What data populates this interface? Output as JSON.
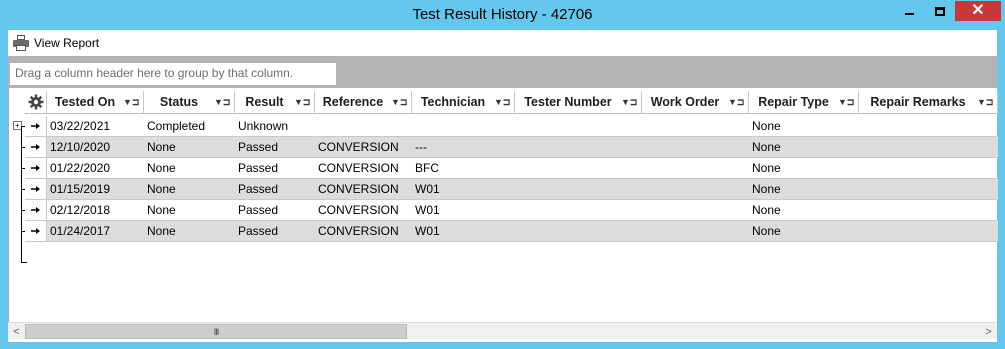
{
  "window": {
    "title": "Test Result History - 42706",
    "controls": {
      "minimize": "minimize",
      "maximize": "maximize",
      "close": "✕"
    }
  },
  "toolbar": {
    "view_report_label": "View Report",
    "icon": "printer-icon"
  },
  "group_panel": {
    "hint": "Drag a column header here to group by that column."
  },
  "grid": {
    "columns": [
      {
        "key": "tested_on",
        "label": "Tested On"
      },
      {
        "key": "status",
        "label": "Status"
      },
      {
        "key": "result",
        "label": "Result"
      },
      {
        "key": "reference",
        "label": "Reference"
      },
      {
        "key": "technician",
        "label": "Technician"
      },
      {
        "key": "tester_number",
        "label": "Tester Number"
      },
      {
        "key": "work_order",
        "label": "Work Order"
      },
      {
        "key": "repair_type",
        "label": "Repair Type"
      },
      {
        "key": "repair_remarks",
        "label": "Repair Remarks"
      }
    ],
    "rows": [
      {
        "tested_on": "03/22/2021",
        "status": "Completed",
        "result": "Unknown",
        "reference": "",
        "technician": "",
        "tester_number": "",
        "work_order": "",
        "repair_type": "None",
        "repair_remarks": ""
      },
      {
        "tested_on": "12/10/2020",
        "status": "None",
        "result": "Passed",
        "reference": "CONVERSION",
        "technician": "---",
        "tester_number": "",
        "work_order": "",
        "repair_type": "None",
        "repair_remarks": ""
      },
      {
        "tested_on": "01/22/2020",
        "status": "None",
        "result": "Passed",
        "reference": "CONVERSION",
        "technician": "BFC",
        "tester_number": "",
        "work_order": "",
        "repair_type": "None",
        "repair_remarks": ""
      },
      {
        "tested_on": "01/15/2019",
        "status": "None",
        "result": "Passed",
        "reference": "CONVERSION",
        "technician": "W01",
        "tester_number": "",
        "work_order": "",
        "repair_type": "None",
        "repair_remarks": ""
      },
      {
        "tested_on": "02/12/2018",
        "status": "None",
        "result": "Passed",
        "reference": "CONVERSION",
        "technician": "W01",
        "tester_number": "",
        "work_order": "",
        "repair_type": "None",
        "repair_remarks": ""
      },
      {
        "tested_on": "01/24/2017",
        "status": "None",
        "result": "Passed",
        "reference": "CONVERSION",
        "technician": "W01",
        "tester_number": "",
        "work_order": "",
        "repair_type": "None",
        "repair_remarks": ""
      }
    ]
  },
  "scrollbar": {
    "thumb_grip": "III"
  },
  "colors": {
    "title_bar": "#64c8ee",
    "close_button": "#c7383a",
    "alt_row": "#dcdcdc",
    "group_panel": "#b3b3b3"
  }
}
